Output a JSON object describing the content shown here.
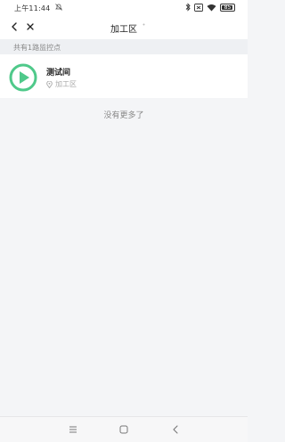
{
  "status_bar": {
    "time": "上午11:44",
    "battery": "85"
  },
  "nav": {
    "title": "加工区"
  },
  "summary": {
    "count_text": "共有1路监控点"
  },
  "monitors": [
    {
      "name": "测试间",
      "location": "加工区",
      "icon": "play-icon"
    }
  ],
  "footer": {
    "no_more_text": "没有更多了"
  },
  "colors": {
    "accent": "#4fc98a",
    "background": "#f4f5f7"
  }
}
